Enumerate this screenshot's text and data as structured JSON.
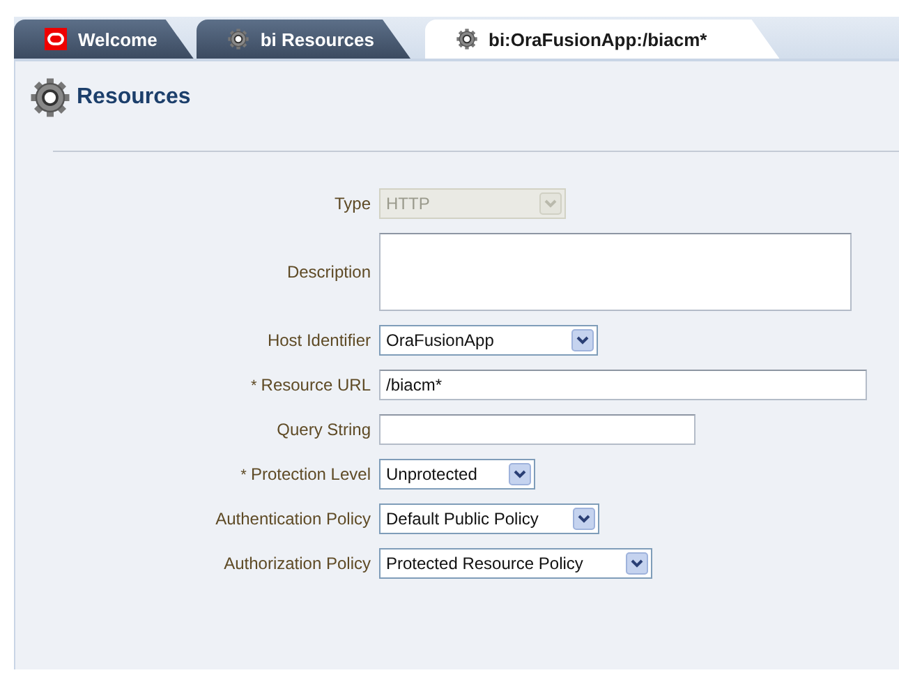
{
  "tabs": [
    {
      "label": "Welcome",
      "selected": false
    },
    {
      "label": "bi Resources",
      "selected": false
    },
    {
      "label": "bi:OraFusionApp:/biacm*",
      "selected": true
    }
  ],
  "panel": {
    "title": "Resources"
  },
  "fields": [
    {
      "label": "Type",
      "kind": "select",
      "value": "HTTP",
      "disabled": true
    },
    {
      "label": "Description",
      "kind": "textarea",
      "disabled": false
    },
    {
      "label": "Host Identifier",
      "kind": "select",
      "value": "OraFusionApp",
      "disabled": false
    },
    {
      "label": "Resource URL",
      "kind": "text",
      "value": "/biacm*",
      "required_mark": "*",
      "disabled": false
    },
    {
      "label": "Query String",
      "kind": "text",
      "disabled": false
    },
    {
      "label": "Protection Level",
      "kind": "select",
      "value": "Unprotected",
      "required_mark": "*",
      "disabled": false
    },
    {
      "label": "Authentication Policy",
      "kind": "select",
      "value": "Default Public Policy",
      "disabled": false
    },
    {
      "label": "Authorization Policy",
      "kind": "select",
      "value": "Protected Resource Policy",
      "disabled": false
    }
  ]
}
